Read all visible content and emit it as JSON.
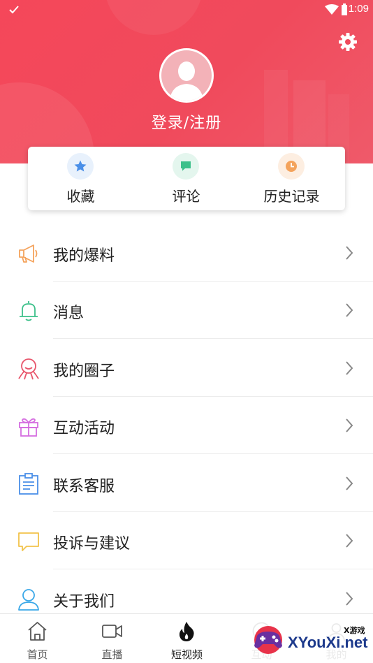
{
  "status_bar": {
    "time": "1:09"
  },
  "header": {
    "login_label": "登录/注册"
  },
  "quick_actions": [
    {
      "label": "收藏",
      "icon": "star-icon",
      "color": "#4a8fe8",
      "bg": "#e8f1fc"
    },
    {
      "label": "评论",
      "icon": "comment-icon",
      "color": "#3cc08a",
      "bg": "#e4f6ee"
    },
    {
      "label": "历史记录",
      "icon": "clock-icon",
      "color": "#f4a35c",
      "bg": "#fdeee1"
    }
  ],
  "menu": [
    {
      "label": "我的爆料",
      "icon": "megaphone-icon",
      "color": "#f4a35c"
    },
    {
      "label": "消息",
      "icon": "bell-icon",
      "color": "#3cc08a"
    },
    {
      "label": "我的圈子",
      "icon": "circle-group-icon",
      "color": "#e8566c"
    },
    {
      "label": "互动活动",
      "icon": "gift-icon",
      "color": "#d56ee0"
    },
    {
      "label": "联系客服",
      "icon": "clipboard-icon",
      "color": "#4a8fe8"
    },
    {
      "label": "投诉与建议",
      "icon": "chat-bubble-icon",
      "color": "#f2c34a"
    },
    {
      "label": "关于我们",
      "icon": "user-icon",
      "color": "#3aa8e8"
    }
  ],
  "tabs": [
    {
      "label": "首页",
      "icon": "home-icon"
    },
    {
      "label": "直播",
      "icon": "video-camera-icon"
    },
    {
      "label": "短视频",
      "icon": "flame-icon"
    },
    {
      "label": "互动",
      "icon": "interaction-icon"
    },
    {
      "label": "我的",
      "icon": "profile-icon"
    }
  ],
  "watermark": {
    "small": "X游戏",
    "text": "XYouXi.net"
  },
  "colors": {
    "header_red": "#f5475a",
    "accent_text": "#222222"
  }
}
